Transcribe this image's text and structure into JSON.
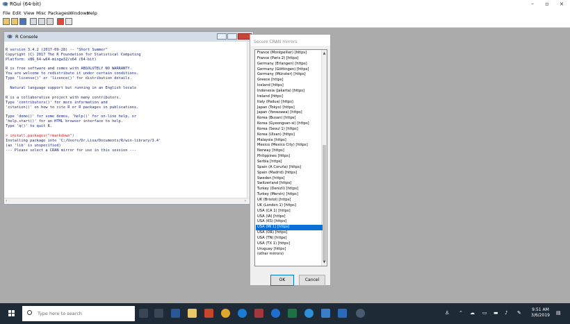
{
  "app": {
    "title": "RGui (64-bit)",
    "controls": {
      "minimize": "–",
      "maximize": "▫",
      "close": "×"
    }
  },
  "menu": [
    "File",
    "Edit",
    "View",
    "Misc",
    "Packages",
    "Windows",
    "Help"
  ],
  "console": {
    "title": "R Console",
    "lines": [
      {
        "text": "",
        "color": "blue"
      },
      {
        "text": "R version 3.4.2 (2017-09-28) -- \"Short Summer\"",
        "color": "blue"
      },
      {
        "text": "Copyright (C) 2017 The R Foundation for Statistical Computing",
        "color": "blue"
      },
      {
        "text": "Platform: x86_64-w64-mingw32/x64 (64-bit)",
        "color": "blue"
      },
      {
        "text": "",
        "color": "blue"
      },
      {
        "text": "R is free software and comes with ABSOLUTELY NO WARRANTY.",
        "color": "blue"
      },
      {
        "text": "You are welcome to redistribute it under certain conditions.",
        "color": "blue"
      },
      {
        "text": "Type 'license()' or 'licence()' for distribution details.",
        "color": "blue"
      },
      {
        "text": "",
        "color": "blue"
      },
      {
        "text": "  Natural language support but running in an English locale",
        "color": "blue"
      },
      {
        "text": "",
        "color": "blue"
      },
      {
        "text": "R is a collaborative project with many contributors.",
        "color": "blue"
      },
      {
        "text": "Type 'contributors()' for more information and",
        "color": "blue"
      },
      {
        "text": "'citation()' on how to cite R or R packages in publications.",
        "color": "blue"
      },
      {
        "text": "",
        "color": "blue"
      },
      {
        "text": "Type 'demo()' for some demos, 'help()' for on-line help, or",
        "color": "blue"
      },
      {
        "text": "'help.start()' for an HTML browser interface to help.",
        "color": "blue"
      },
      {
        "text": "Type 'q()' to quit R.",
        "color": "blue"
      },
      {
        "text": "",
        "color": "blue"
      },
      {
        "text": "> install.packages(\"rmarkdown\")",
        "color": "red"
      },
      {
        "text": "Installing package into 'C:/Users/Dr.Lisa/Documents/R/win-library/3.4'",
        "color": "blue"
      },
      {
        "text": "(as 'lib' is unspecified)",
        "color": "blue"
      },
      {
        "text": "--- Please select a CRAN mirror for use in this session ---",
        "color": "blue"
      }
    ]
  },
  "dialog": {
    "title": "Secure CRAN mirrors",
    "items": [
      "France (Montpellier) [https]",
      "France (Paris 2) [https]",
      "Germany (Erlangen) [https]",
      "Germany (Göttingen) [https]",
      "Germany (Münster) [https]",
      "Greece [https]",
      "Iceland [https]",
      "Indonesia (Jakarta) [https]",
      "Ireland [https]",
      "Italy (Padua) [https]",
      "Japan (Tokyo) [https]",
      "Japan (Yonezawa) [https]",
      "Korea (Busan) [https]",
      "Korea (Gyeongsan-si) [https]",
      "Korea (Seoul 1) [https]",
      "Korea (Ulsan) [https]",
      "Malaysia [https]",
      "Mexico (Mexico City) [https]",
      "Norway [https]",
      "Philippines [https]",
      "Serbia [https]",
      "Spain (A Coruña) [https]",
      "Spain (Madrid) [https]",
      "Sweden [https]",
      "Switzerland [https]",
      "Turkey (Denizli) [https]",
      "Turkey (Mersin) [https]",
      "UK (Bristol) [https]",
      "UK (London 1) [https]",
      "USA (CA 1) [https]",
      "USA (IA) [https]",
      "USA (KS) [https]",
      "USA (MI 1) [https]",
      "USA (OR) [https]",
      "USA (TN) [https]",
      "USA (TX 1) [https]",
      "Uruguay [https]",
      "(other mirrors)"
    ],
    "selected_index": 32,
    "ok_label": "OK",
    "cancel_label": "Cancel"
  },
  "taskbar": {
    "search_placeholder": "Type here to search",
    "time": "9:51 AM",
    "date": "3/6/2019"
  },
  "colors": {
    "console_text": "#14237a",
    "console_command": "#c02020",
    "selection": "#0a6fd6",
    "workspace": "#ababab",
    "taskbar": "#1f2a37"
  }
}
